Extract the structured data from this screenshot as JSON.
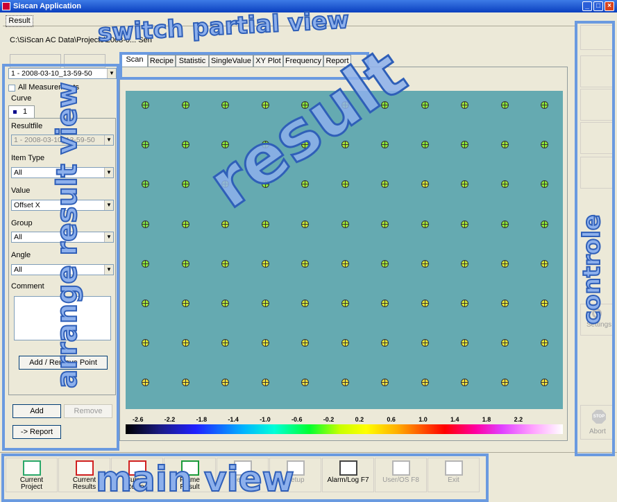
{
  "window": {
    "title": "Siscan Application"
  },
  "result_tab": "Result",
  "project_path": "C:\\SiScan AC Data\\Projects\\2008-0... Sen",
  "left_panel": {
    "measurement_select": "1 - 2008-03-10_13-59-50",
    "all_measurements_label": "All Measurements",
    "all_measurements_checked": false,
    "curve_label": "Curve",
    "curve_tab": "1",
    "resultfile_label": "Resultfile",
    "resultfile_value": "1 - 2008-03-10_13-59-50",
    "item_type_label": "Item Type",
    "item_type_value": "All",
    "value_label": "Value",
    "value_value": "Offset X",
    "group_label": "Group",
    "group_value": "All",
    "angle_label": "Angle",
    "angle_value": "All",
    "comment_label": "Comment",
    "comment_value": "",
    "add_remove_point": "Add / Remove Point",
    "add": "Add",
    "remove": "Remove",
    "report": "-> Report"
  },
  "tabs": [
    "Scan",
    "Recipe",
    "Statistic",
    "SingleValue",
    "XY Plot",
    "Frequency",
    "Report"
  ],
  "active_tab": "Scan",
  "scan": {
    "background_color": "#65aab1",
    "grid": {
      "rows": [
        [
          "#7ee04a",
          "#8ce83a",
          "#8ce83a",
          "#9fe83a",
          "#8ce83a",
          "#9fe83a",
          "#8ce83a",
          "#8ce83a",
          "#9fe83a",
          "#8ce83a",
          "#8ce83a"
        ],
        [
          "#7ee04a",
          "#8ce83a",
          "#8ce83a",
          "#8ce83a",
          "#9fe83a",
          "#a8e838",
          "#8ce83a",
          "#8ce83a",
          "#8ce83a",
          "#9fe83a",
          "#8ce83a"
        ],
        [
          "#7ee04a",
          "#8ce83a",
          "#a8e838",
          "#8ce83a",
          "#9fe83a",
          "#a8e838",
          "#a8e838",
          "#d8e838",
          "#a8e838",
          "#9fe83a",
          "#8ce83a"
        ],
        [
          "#7ee04a",
          "#9fe83a",
          "#b8e838",
          "#a8e838",
          "#c8e838",
          "#9fe83a",
          "#a8e838",
          "#a8e838",
          "#a8e838",
          "#8ce83a",
          "#8ce83a"
        ],
        [
          "#8ce83a",
          "#9fe83a",
          "#b8e838",
          "#d8e838",
          "#c8e838",
          "#d8e838",
          "#a8e838",
          "#d8e838",
          "#c8e838",
          "#d8e838",
          "#d8e838"
        ],
        [
          "#a8e838",
          "#c8e838",
          "#b8e838",
          "#c8e838",
          "#d8e838",
          "#c8e838",
          "#d8e838",
          "#e8e838",
          "#d8e838",
          "#e8e838",
          "#e8e838"
        ],
        [
          "#d8e838",
          "#e8e838",
          "#d8e838",
          "#e8e838",
          "#e8e838",
          "#e8e838",
          "#e8e838",
          "#e8e838",
          "#e8e838",
          "#e8e838",
          "#e8e838"
        ],
        [
          "#f0e040",
          "#f0e040",
          "#f0e040",
          "#f0e040",
          "#f0e040",
          "#f0e040",
          "#f0e040",
          "#f0e040",
          "#f0e040",
          "#f0e040",
          "#f0e040"
        ]
      ]
    },
    "colorbar_ticks": [
      "-2.6",
      "-2.2",
      "-1.8",
      "-1.4",
      "-1.0",
      "-0.6",
      "-0.2",
      "0.2",
      "0.6",
      "1.0",
      "1.4",
      "1.8",
      "2.2"
    ]
  },
  "right_panel": {
    "settings": "Settings",
    "abort": "Abort",
    "stop_sign": "STOP"
  },
  "toolbar": [
    {
      "label1": "Current",
      "label2": "Project",
      "icon": "project-icon",
      "enabled": true
    },
    {
      "label1": "Current",
      "label2": "Results",
      "icon": "results-icon",
      "enabled": true
    },
    {
      "label1": "Current",
      "label2": "Recipe",
      "icon": "recipe-icon",
      "enabled": true
    },
    {
      "label1": "Frame",
      "label2": "Result",
      "icon": "frame-icon",
      "enabled": true
    },
    {
      "label1": "",
      "label2": "Recipe",
      "icon": "recipe-grid-icon",
      "enabled": false
    },
    {
      "label1": "",
      "label2": "Setup",
      "icon": "setup-icon",
      "enabled": false
    },
    {
      "label1": "",
      "label2": "Alarm/Log F7",
      "icon": "alarm-icon",
      "enabled": true
    },
    {
      "label1": "",
      "label2": "User/OS F8",
      "icon": "user-icon",
      "enabled": false
    },
    {
      "label1": "",
      "label2": "Exit",
      "icon": "exit-icon",
      "enabled": false
    }
  ],
  "annotations": {
    "switch_partial_view": "switch partial view",
    "arrange_result_view": "arrange result view",
    "result": "result",
    "controle": "controle",
    "main_view": "main view"
  }
}
